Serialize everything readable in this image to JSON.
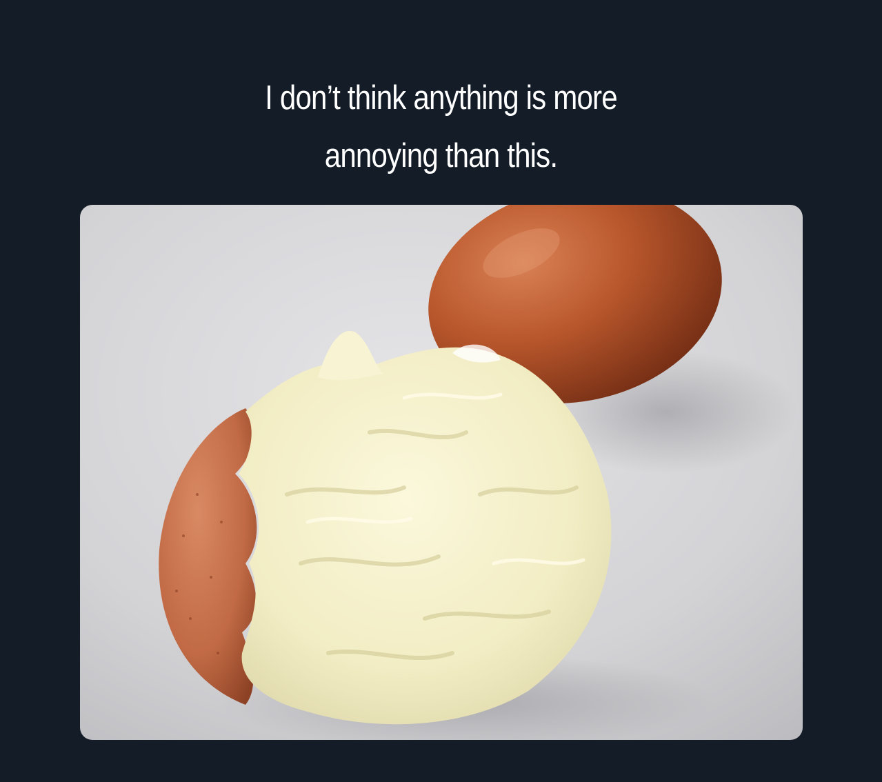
{
  "caption": {
    "line1": "I don’t think anything is more",
    "line2": "annoying than this."
  },
  "colors": {
    "background": "#131c27",
    "caption_text": "#ffffff",
    "surface": "#d8d8db",
    "eggshell_brown": "#c9633f",
    "egg_white": "#f3efc9"
  },
  "photo": {
    "subject": "badly peeled hard-boiled egg next to an unpeeled brown egg"
  }
}
